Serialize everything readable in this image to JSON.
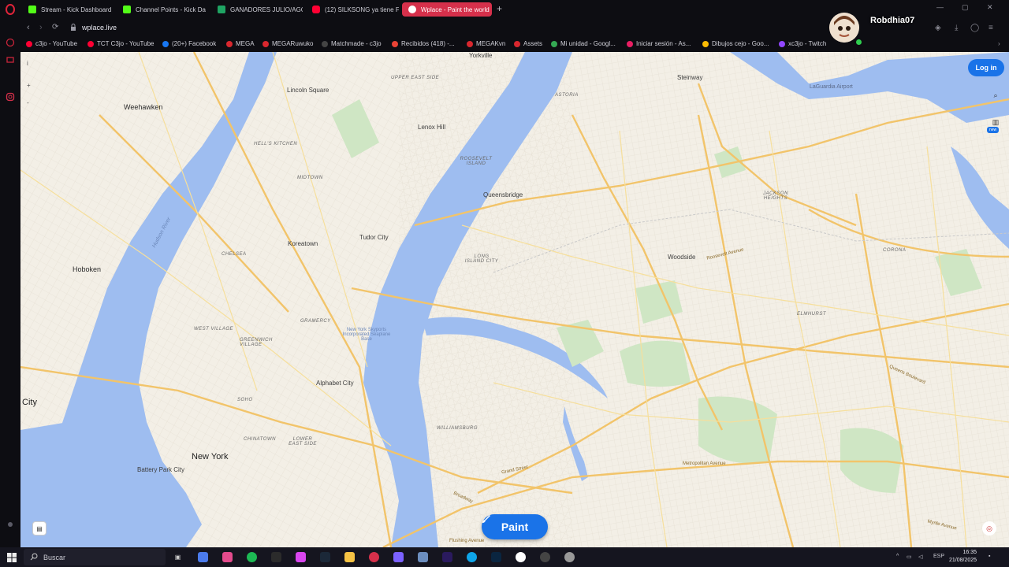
{
  "browser": {
    "tabs": [
      {
        "label": "Stream - Kick Dashboard",
        "color": "#53fc18"
      },
      {
        "label": "Channel Points - Kick Da",
        "color": "#53fc18"
      },
      {
        "label": "GANADORES JULIO/AGO",
        "color": "#1fa463"
      },
      {
        "label": "(12) SILKSONG ya tiene F",
        "color": "#ff0033"
      },
      {
        "label": "Wplace - Paint the world",
        "color": "#ffffff",
        "active": true
      }
    ],
    "url": "wplace.live",
    "bookmarks": [
      {
        "label": "c3jo - YouTube",
        "color": "#ff0033"
      },
      {
        "label": "TCT C3jo - YouTube",
        "color": "#ff0033"
      },
      {
        "label": "(20+) Facebook",
        "color": "#1877f2"
      },
      {
        "label": "MEGA",
        "color": "#d9272e"
      },
      {
        "label": "MEGARuwuko",
        "color": "#d9272e"
      },
      {
        "label": "Matchmade - c3jo",
        "color": "#444"
      },
      {
        "label": "Recibidos (418) -...",
        "color": "#ea4335"
      },
      {
        "label": "MEGAKvn",
        "color": "#d9272e"
      },
      {
        "label": "Assets",
        "color": "#d9272e"
      },
      {
        "label": "Mi unidad - Googl...",
        "color": "#34a853"
      },
      {
        "label": "Iniciar sesión - As...",
        "color": "#e91e63"
      },
      {
        "label": "Dibujos cejo - Goo...",
        "color": "#fbbc04"
      },
      {
        "label": "xc3jo - Twitch",
        "color": "#9146ff"
      }
    ]
  },
  "streamer": {
    "name": "Robdhia07"
  },
  "map": {
    "labels": {
      "weehawken": "Weehawken",
      "hoboken": "Hoboken",
      "city": "City",
      "lincoln_square": "Lincoln Square",
      "lenox_hill": "Lenox Hill",
      "tudor_city": "Tudor City",
      "koreatown": "Koreatown",
      "chelsea": "CHELSEA",
      "gramercy": "GRAMERCY",
      "west_village": "WEST VILLAGE",
      "greenwich_village": "GREENWICH VILLAGE",
      "alphabet_city": "Alphabet City",
      "soho": "SOHO",
      "chinatown": "CHINATOWN",
      "lower_east_side": "LOWER EAST SIDE",
      "new_york": "New York",
      "battery_park_city": "Battery Park City",
      "hells_kitchen": "HELL'S KITCHEN",
      "midtown": "MIDTOWN",
      "upper_east_side": "UPPER EAST SIDE",
      "yorkville": "Yorkville",
      "astoria": "ASTORIA",
      "queensbridge": "Queensbridge",
      "long_island_city": "LONG ISLAND CITY",
      "roosevelt_island": "ROOSEVELT ISLAND",
      "steinway": "Steinway",
      "laguardia": "LaGuardia Airport",
      "jackson_heights": "JACKSON HEIGHTS",
      "woodside": "Woodside",
      "corona": "CORONA",
      "elmhurst": "ELMHURST",
      "williamsburg": "WILLIAMSBURG",
      "seaplane_base": "New York Skyports Incorporated Seaplane Base",
      "hudson_river": "Hudson River",
      "metropolitan_ave": "Metropolitan Avenue",
      "queens_blvd": "Queens Boulevard",
      "grand_street": "Grand Street",
      "broadway": "Broadway",
      "myrtle_ave": "Myrtle Avenue",
      "roosevelt_ave": "Roosevelt Avenue",
      "flushing_ave": "Flushing Avenue"
    },
    "login_label": "Log in",
    "paint_label": "Paint",
    "new_badge": "new"
  },
  "taskbar": {
    "search_placeholder": "Buscar",
    "lang": "ESP",
    "time": "16:35",
    "date": "21/08/2025"
  }
}
